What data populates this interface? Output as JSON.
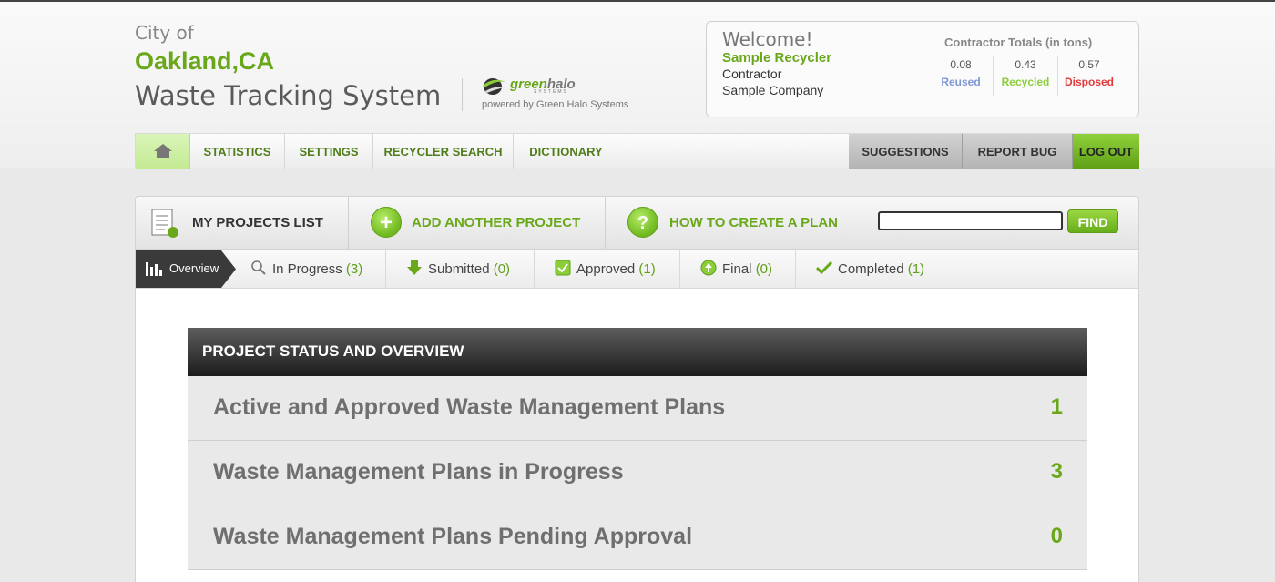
{
  "brand": {
    "city_of": "City of",
    "city_name": "Oakland,CA",
    "system_title": "Waste Tracking System",
    "logo_green": "green",
    "logo_halo": "halo",
    "logo_systems": "SYSTEMS",
    "powered_by": "powered by Green Halo Systems"
  },
  "user": {
    "welcome": "Welcome!",
    "name": "Sample Recycler",
    "role": "Contractor",
    "company": "Sample Company"
  },
  "totals": {
    "title": "Contractor Totals (in tons)",
    "reused": {
      "value": "0.08",
      "label": "Reused",
      "color": "#7f97d6"
    },
    "recycled": {
      "value": "0.43",
      "label": "Recycled",
      "color": "#8ccd3a"
    },
    "disposed": {
      "value": "0.57",
      "label": "Disposed",
      "color": "#e23a3a"
    }
  },
  "nav": {
    "home_icon": "home-icon",
    "items": [
      "STATISTICS",
      "SETTINGS",
      "RECYCLER SEARCH",
      "DICTIONARY"
    ],
    "right": [
      "SUGGESTIONS",
      "REPORT BUG",
      "LOG OUT"
    ]
  },
  "toolbar": {
    "my_projects": "MY PROJECTS LIST",
    "add_project": "ADD ANOTHER PROJECT",
    "how_to": "HOW TO CREATE A PLAN",
    "search_value": "",
    "find": "FIND"
  },
  "tabs": {
    "overview": "Overview",
    "items": [
      {
        "label": "In Progress",
        "count": "(3)",
        "icon": "magnifier-icon"
      },
      {
        "label": "Submitted",
        "count": "(0)",
        "icon": "arrow-down-icon"
      },
      {
        "label": "Approved",
        "count": "(1)",
        "icon": "checkbox-icon"
      },
      {
        "label": "Final",
        "count": "(0)",
        "icon": "final-icon"
      },
      {
        "label": "Completed",
        "count": "(1)",
        "icon": "checkmark-icon"
      }
    ]
  },
  "status": {
    "title": "PROJECT STATUS AND OVERVIEW",
    "rows": [
      {
        "label": "Active and Approved Waste Management Plans",
        "value": "1"
      },
      {
        "label": "Waste Management Plans in Progress",
        "value": "3"
      },
      {
        "label": "Waste Management Plans Pending Approval",
        "value": "0"
      }
    ]
  }
}
